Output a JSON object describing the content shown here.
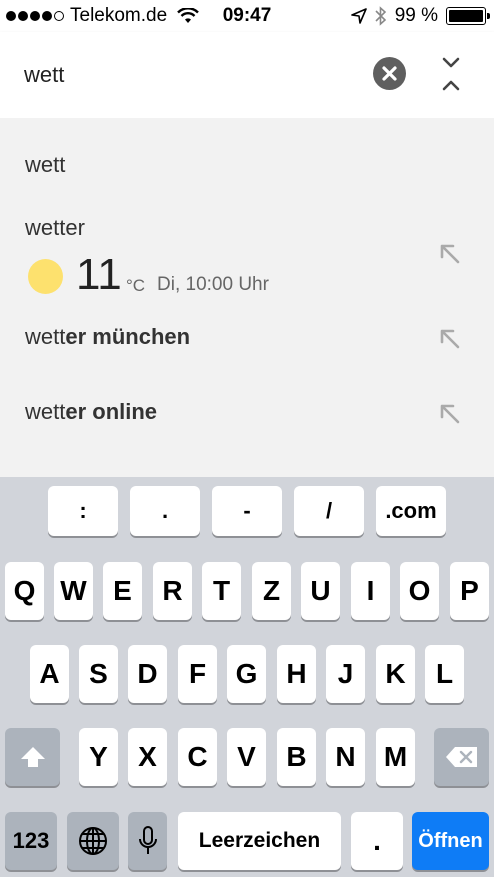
{
  "status_bar": {
    "carrier": "Telekom.de",
    "time": "09:47",
    "battery_text": "99 %",
    "battery_level": 0.99
  },
  "search": {
    "query": "wett"
  },
  "suggestions": [
    {
      "text": "wett",
      "prefix": "wett",
      "suffix": ""
    },
    {
      "text": "wetter",
      "prefix": "wetter",
      "suffix": ""
    },
    {
      "text": "wetter münchen",
      "prefix": "wett",
      "suffix": "er münchen"
    },
    {
      "text": "wetter online",
      "prefix": "wett",
      "suffix": "er online"
    }
  ],
  "weather": {
    "temperature": "11",
    "unit": "°C",
    "time": "Di, 10:00 Uhr"
  },
  "keyboard": {
    "symbols": [
      ":",
      ".",
      "-",
      "/",
      ".com"
    ],
    "row1": [
      "Q",
      "W",
      "E",
      "R",
      "T",
      "Z",
      "U",
      "I",
      "O",
      "P"
    ],
    "row2": [
      "A",
      "S",
      "D",
      "F",
      "G",
      "H",
      "J",
      "K",
      "L"
    ],
    "row3": [
      "Y",
      "X",
      "C",
      "V",
      "B",
      "N",
      "M"
    ],
    "numbers_label": "123",
    "space_label": "Leerzeichen",
    "period_label": ".",
    "go_label": "Öffnen"
  },
  "colors": {
    "accent_blue": "#0e7cf6",
    "sun_yellow": "#fde16e",
    "keyboard_bg": "#d1d4da"
  }
}
